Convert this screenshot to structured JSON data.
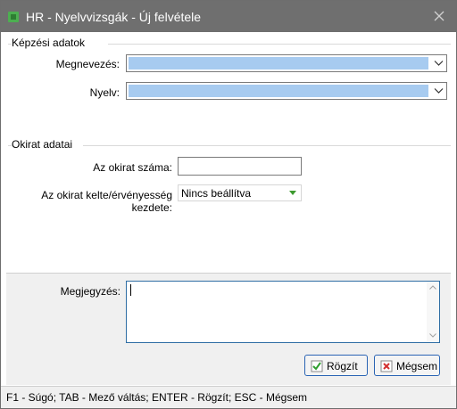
{
  "window": {
    "title": "HR - Nyelvvizsgák - Új felvétele"
  },
  "training_group": {
    "title": "Képzési adatok",
    "name_label": "Megnevezés:",
    "name_value": "",
    "language_label": "Nyelv:",
    "language_value": ""
  },
  "certificate_group": {
    "title": "Okirat adatai",
    "number_label": "Az okirat száma:",
    "number_value": "",
    "date_label": "Az okirat kelte/érvényesség kezdete:",
    "date_value": "Nincs beállítva"
  },
  "note": {
    "label": "Megjegyzés:",
    "value": ""
  },
  "buttons": {
    "save": "Rögzít",
    "cancel": "Mégsem"
  },
  "status_bar": {
    "text": "F1 - Súgó; TAB - Mező váltás; ENTER - Rögzít; ESC - Mégsem"
  },
  "colors": {
    "titlebar": "#6f6f6f",
    "selection": "#a7cbf0",
    "focus_border": "#2e6da4",
    "dropdown_accent": "#3c9a2e"
  }
}
